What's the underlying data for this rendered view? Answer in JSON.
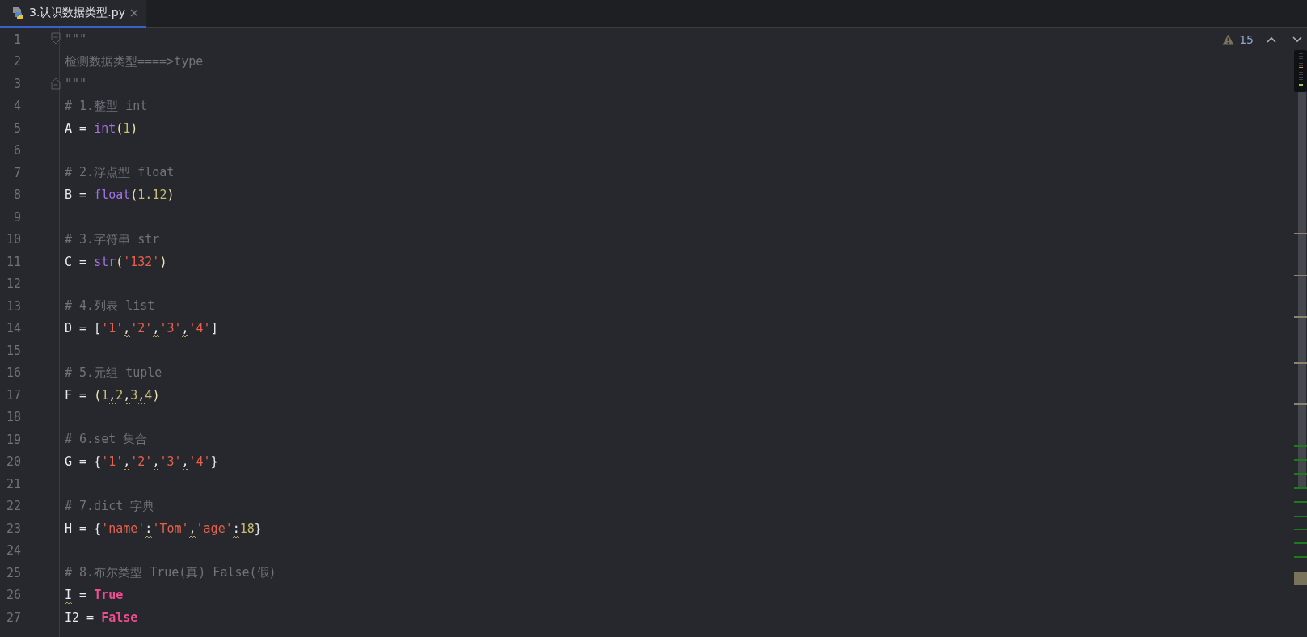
{
  "tabs": [
    {
      "title": "3.认识数据类型.py",
      "selected": true
    }
  ],
  "inspections": {
    "count": "15"
  },
  "lines": [
    {
      "number": "1",
      "fold_start": true,
      "tokens": [
        {
          "text": "\"\"\"",
          "kind": "docstring"
        }
      ]
    },
    {
      "number": "2",
      "tokens": [
        {
          "text": "检测数据类型====>type",
          "kind": "docstring"
        }
      ]
    },
    {
      "number": "3",
      "fold_end": true,
      "tokens": [
        {
          "text": "\"\"\"",
          "kind": "docstring"
        }
      ]
    },
    {
      "number": "4",
      "tokens": [
        {
          "text": "# 1.整型 int",
          "kind": "comment"
        }
      ]
    },
    {
      "number": "5",
      "tokens": [
        {
          "text": "A = ",
          "kind": "ident"
        },
        {
          "text": "int",
          "kind": "builtin"
        },
        {
          "text": "(",
          "kind": "paren"
        },
        {
          "text": "1",
          "kind": "number"
        },
        {
          "text": ")",
          "kind": "paren"
        }
      ]
    },
    {
      "number": "6"
    },
    {
      "number": "7",
      "tokens": [
        {
          "text": "# 2.浮点型 float",
          "kind": "comment"
        }
      ]
    },
    {
      "number": "8",
      "tokens": [
        {
          "text": "B = ",
          "kind": "ident"
        },
        {
          "text": "float",
          "kind": "builtin"
        },
        {
          "text": "(",
          "kind": "paren"
        },
        {
          "text": "1.12",
          "kind": "number"
        },
        {
          "text": ")",
          "kind": "paren"
        }
      ]
    },
    {
      "number": "9"
    },
    {
      "number": "10",
      "tokens": [
        {
          "text": "# 3.字符串 str",
          "kind": "comment"
        }
      ]
    },
    {
      "number": "11",
      "tokens": [
        {
          "text": "C = ",
          "kind": "ident"
        },
        {
          "text": "str",
          "kind": "builtin"
        },
        {
          "text": "(",
          "kind": "paren"
        },
        {
          "text": "'132'",
          "kind": "string"
        },
        {
          "text": ")",
          "kind": "paren"
        }
      ]
    },
    {
      "number": "12"
    },
    {
      "number": "13",
      "tokens": [
        {
          "text": "# 4.列表 list",
          "kind": "comment"
        }
      ]
    },
    {
      "number": "14",
      "tokens": [
        {
          "text": "D = [",
          "kind": "ident"
        },
        {
          "text": "'1'",
          "kind": "string"
        },
        {
          "text": ",",
          "kind": "ident",
          "warning": true
        },
        {
          "text": "'2'",
          "kind": "string"
        },
        {
          "text": ",",
          "kind": "ident",
          "warning": true
        },
        {
          "text": "'3'",
          "kind": "string"
        },
        {
          "text": ",",
          "kind": "ident",
          "warning": true
        },
        {
          "text": "'4'",
          "kind": "string"
        },
        {
          "text": "]",
          "kind": "ident"
        }
      ]
    },
    {
      "number": "15"
    },
    {
      "number": "16",
      "tokens": [
        {
          "text": "# 5.元组 tuple",
          "kind": "comment"
        }
      ]
    },
    {
      "number": "17",
      "tokens": [
        {
          "text": "F = ",
          "kind": "ident"
        },
        {
          "text": "(",
          "kind": "paren"
        },
        {
          "text": "1",
          "kind": "number"
        },
        {
          "text": ",",
          "kind": "ident",
          "warning": true
        },
        {
          "text": "2",
          "kind": "number"
        },
        {
          "text": ",",
          "kind": "ident",
          "warning": true
        },
        {
          "text": "3",
          "kind": "number"
        },
        {
          "text": ",",
          "kind": "ident",
          "warning": true
        },
        {
          "text": "4",
          "kind": "number"
        },
        {
          "text": ")",
          "kind": "paren"
        }
      ]
    },
    {
      "number": "18"
    },
    {
      "number": "19",
      "tokens": [
        {
          "text": "# 6.set 集合",
          "kind": "comment"
        }
      ]
    },
    {
      "number": "20",
      "tokens": [
        {
          "text": "G = {",
          "kind": "ident"
        },
        {
          "text": "'1'",
          "kind": "string"
        },
        {
          "text": ",",
          "kind": "ident",
          "warning": true
        },
        {
          "text": "'2'",
          "kind": "string"
        },
        {
          "text": ",",
          "kind": "ident",
          "warning": true
        },
        {
          "text": "'3'",
          "kind": "string"
        },
        {
          "text": ",",
          "kind": "ident",
          "warning": true
        },
        {
          "text": "'4'",
          "kind": "string"
        },
        {
          "text": "}",
          "kind": "ident"
        }
      ]
    },
    {
      "number": "21"
    },
    {
      "number": "22",
      "tokens": [
        {
          "text": "# 7.dict 字典",
          "kind": "comment"
        }
      ]
    },
    {
      "number": "23",
      "tokens": [
        {
          "text": "H = {",
          "kind": "ident"
        },
        {
          "text": "'name'",
          "kind": "string"
        },
        {
          "text": ":",
          "kind": "ident",
          "warning": true
        },
        {
          "text": "'Tom'",
          "kind": "string"
        },
        {
          "text": ",",
          "kind": "ident",
          "warning": true
        },
        {
          "text": "'age'",
          "kind": "string"
        },
        {
          "text": ":",
          "kind": "ident",
          "warning": true
        },
        {
          "text": "18",
          "kind": "number"
        },
        {
          "text": "}",
          "kind": "ident"
        }
      ]
    },
    {
      "number": "24"
    },
    {
      "number": "25",
      "tokens": [
        {
          "text": "# 8.布尔类型 True(真) False(假)",
          "kind": "comment"
        }
      ]
    },
    {
      "number": "26",
      "tokens": [
        {
          "text": "I",
          "kind": "ident",
          "warning": true
        },
        {
          "text": " = ",
          "kind": "ident"
        },
        {
          "text": "True",
          "kind": "keyword"
        }
      ]
    },
    {
      "number": "27",
      "tokens": [
        {
          "text": "I2 = ",
          "kind": "ident"
        },
        {
          "text": "False",
          "kind": "keyword"
        }
      ]
    }
  ]
}
